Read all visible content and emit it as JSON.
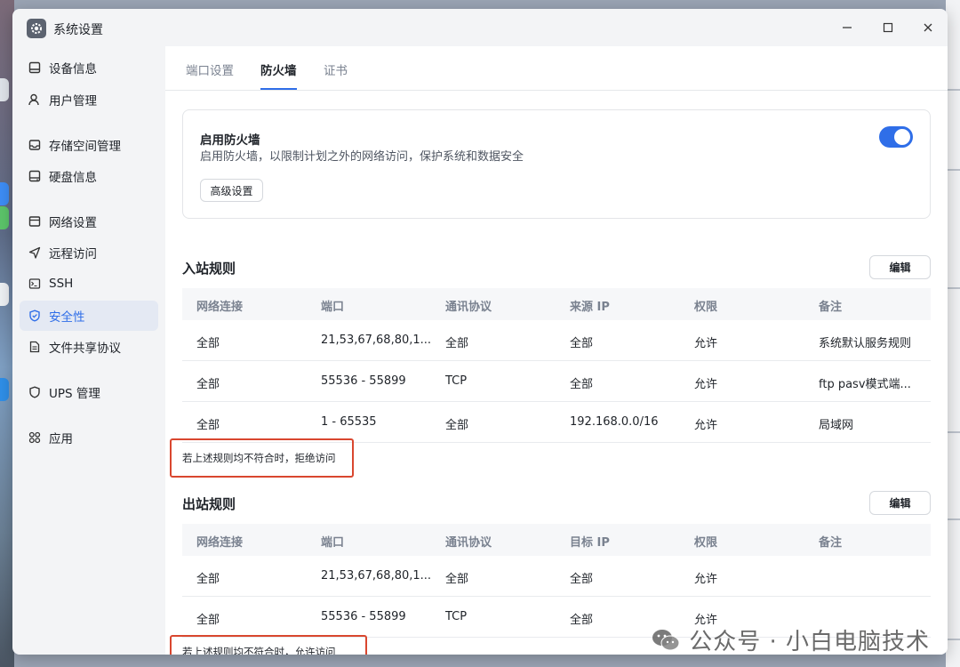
{
  "window": {
    "title": "系统设置",
    "controls": [
      "minimize-icon",
      "maximize-icon",
      "close-icon"
    ]
  },
  "sidebar": {
    "items": [
      {
        "label": "设备信息",
        "icon": "device-icon",
        "active": false
      },
      {
        "label": "用户管理",
        "icon": "user-icon",
        "active": false
      },
      {
        "label": "存储空间管理",
        "icon": "storage-icon",
        "active": false
      },
      {
        "label": "硬盘信息",
        "icon": "disk-icon",
        "active": false
      },
      {
        "label": "网络设置",
        "icon": "network-icon",
        "active": false
      },
      {
        "label": "远程访问",
        "icon": "remote-icon",
        "active": false
      },
      {
        "label": "SSH",
        "icon": "terminal-icon",
        "active": false
      },
      {
        "label": "安全性",
        "icon": "shield-icon",
        "active": true
      },
      {
        "label": "文件共享协议",
        "icon": "file-share-icon",
        "active": false
      },
      {
        "label": "UPS 管理",
        "icon": "ups-icon",
        "active": false
      },
      {
        "label": "应用",
        "icon": "apps-icon",
        "active": false
      }
    ]
  },
  "tabs": [
    {
      "label": "端口设置",
      "active": false
    },
    {
      "label": "防火墙",
      "active": true
    },
    {
      "label": "证书",
      "active": false
    }
  ],
  "firewall": {
    "title": "启用防火墙",
    "description": "启用防火墙，以限制计划之外的网络访问，保护系统和数据安全",
    "enabled": true,
    "advanced_button": "高级设置"
  },
  "inbound": {
    "title": "入站规则",
    "edit_button": "编辑",
    "columns": [
      "网络连接",
      "端口",
      "通讯协议",
      "来源 IP",
      "权限",
      "备注"
    ],
    "rows": [
      [
        "全部",
        "21,53,67,68,80,1...",
        "全部",
        "全部",
        "允许",
        "系统默认服务规则"
      ],
      [
        "全部",
        "55536 - 55899",
        "TCP",
        "全部",
        "允许",
        "ftp pasv模式端..."
      ],
      [
        "全部",
        "1 - 65535",
        "全部",
        "192.168.0.0/16",
        "允许",
        "局域网"
      ]
    ],
    "default_note": "若上述规则均不符合时，拒绝访问"
  },
  "outbound": {
    "title": "出站规则",
    "edit_button": "编辑",
    "columns": [
      "网络连接",
      "端口",
      "通讯协议",
      "目标 IP",
      "权限",
      "备注"
    ],
    "rows": [
      [
        "全部",
        "21,53,67,68,80,1...",
        "全部",
        "全部",
        "允许",
        ""
      ],
      [
        "全部",
        "55536 - 55899",
        "TCP",
        "全部",
        "允许",
        ""
      ]
    ],
    "default_note": "若上述规则均不符合时，允许访问"
  },
  "watermark": "公众号 · 小白电脑技术",
  "colors": {
    "accent": "#2f6ee8",
    "highlight_box": "#d9472f",
    "sidebar_bg": "#f3f4f6",
    "active_nav_bg": "#e4e9f3"
  }
}
